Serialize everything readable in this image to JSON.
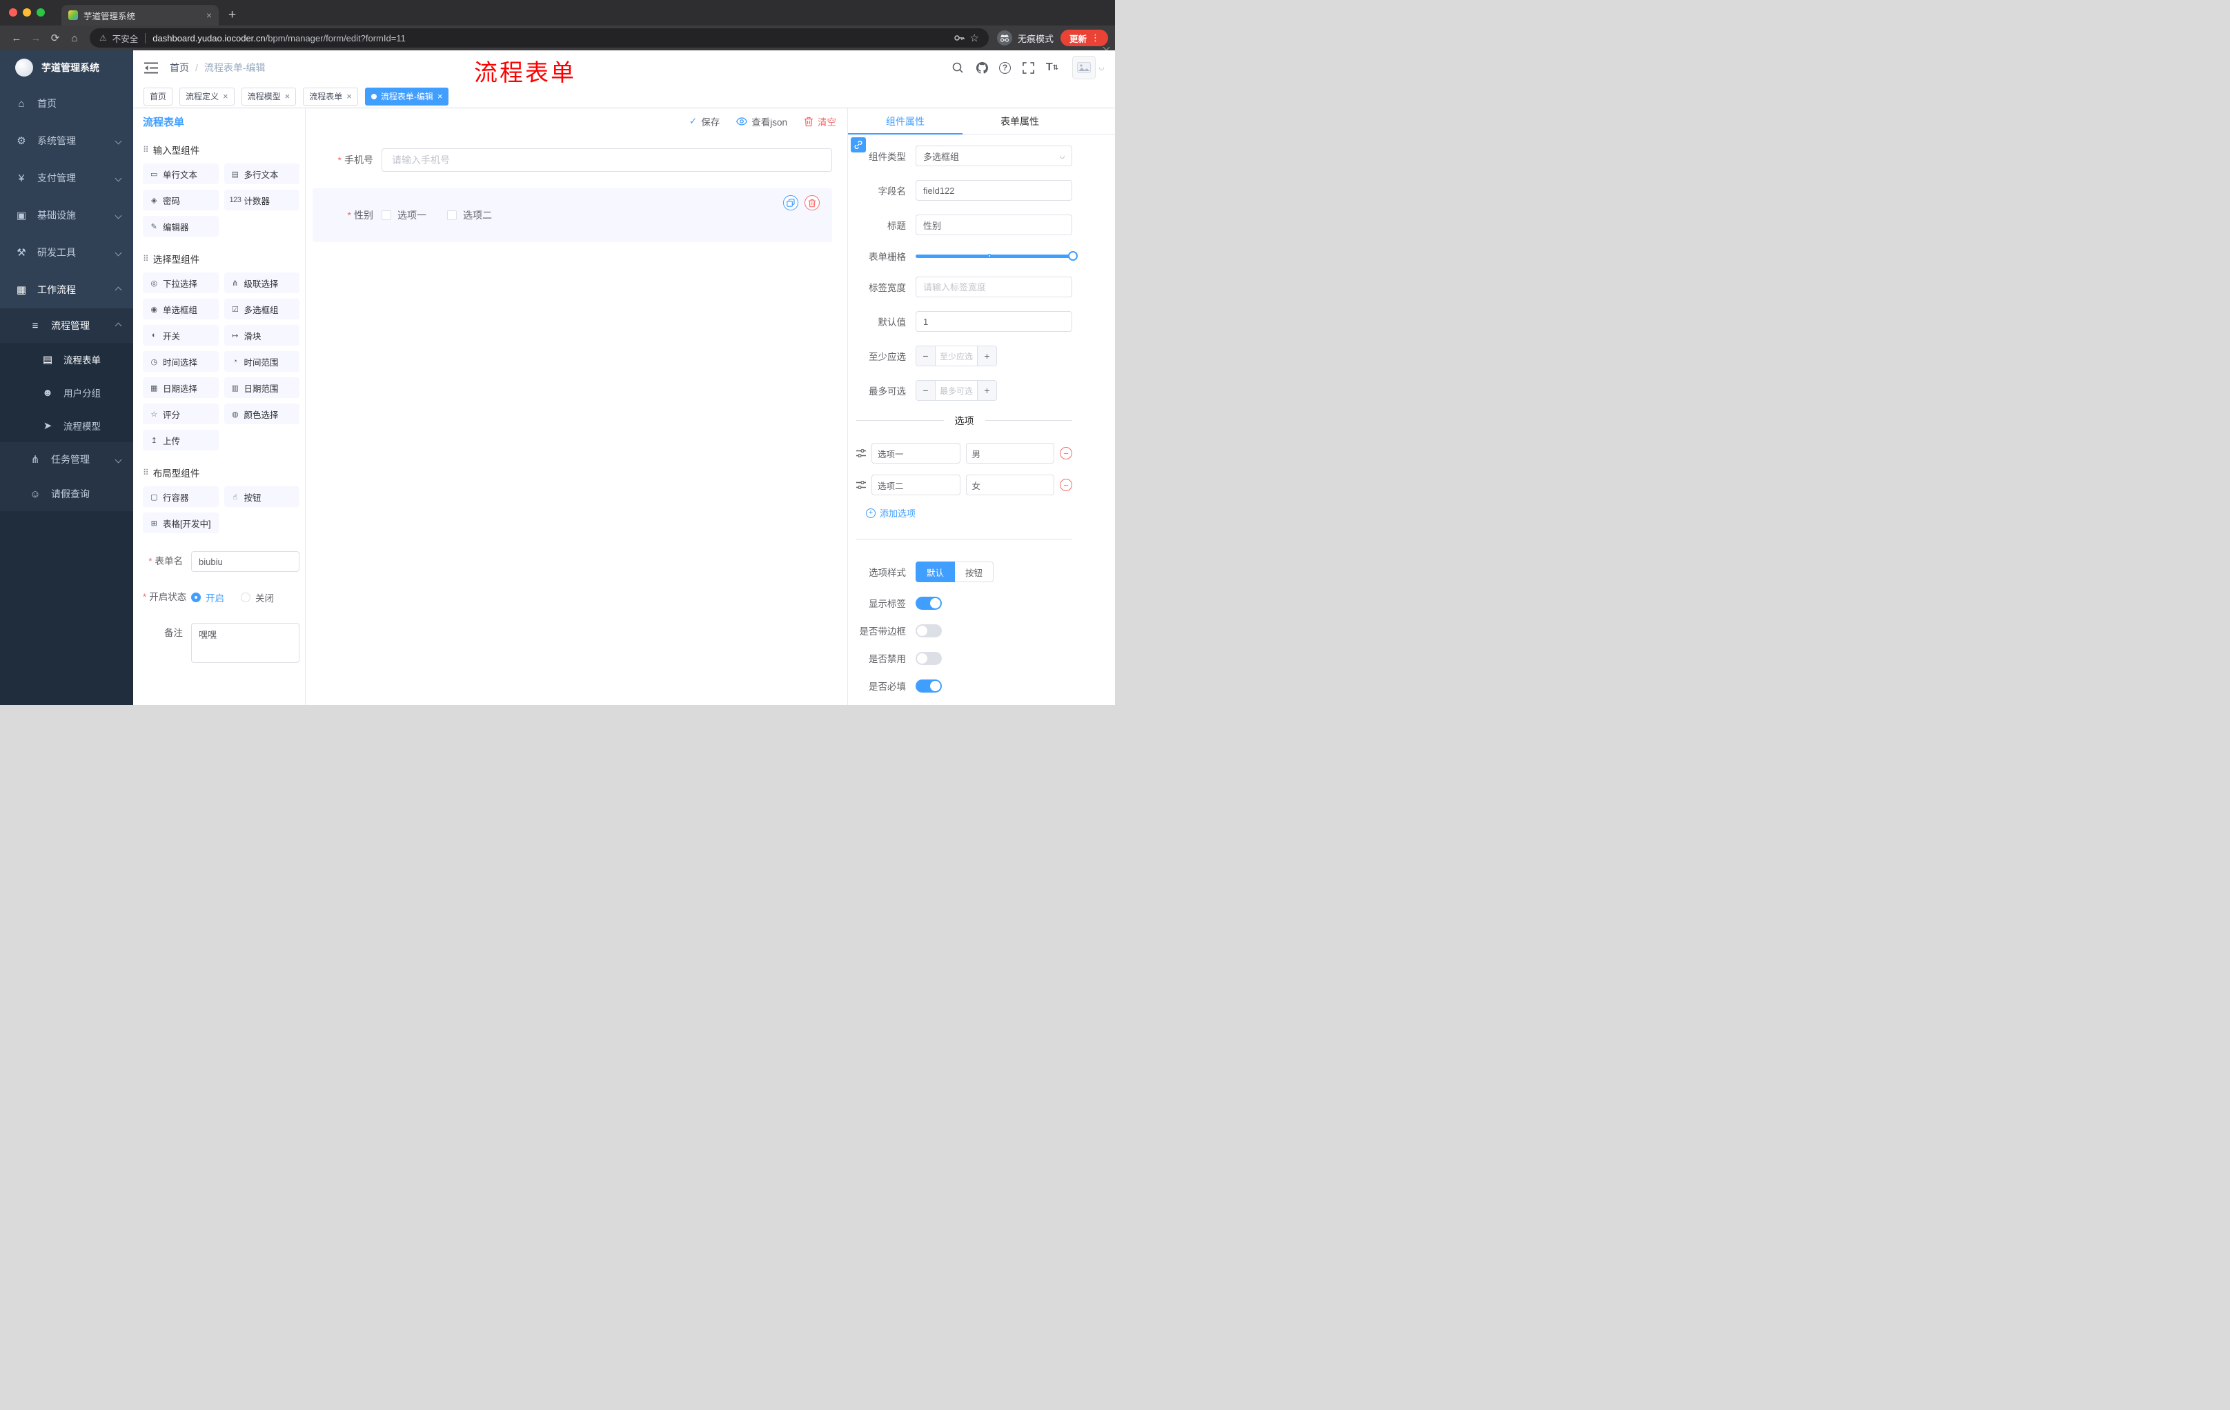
{
  "colors": {
    "primary": "#409eff",
    "danger": "#f56c6c",
    "annotation_red": "#fe0000",
    "sidebar_bg": "#304156",
    "chip_bg": "#f6f7ff",
    "active_tag": "#409eff"
  },
  "browser": {
    "tab_title": "芋道管理系统",
    "security": "不安全",
    "url_host": "dashboard.yudao.iocoder.cn",
    "url_path": "/bpm/manager/form/edit?formId=11",
    "incognito": "无痕模式",
    "update": "更新"
  },
  "annotation": "流程表单",
  "sidebar": {
    "title": "芋道管理系统",
    "items": [
      {
        "label": "首页",
        "glyph": "⌂"
      },
      {
        "label": "系统管理",
        "glyph": "⚙"
      },
      {
        "label": "支付管理",
        "glyph": "¥"
      },
      {
        "label": "基础设施",
        "glyph": "▣"
      },
      {
        "label": "研发工具",
        "glyph": "⚒"
      },
      {
        "label": "工作流程",
        "glyph": "▦"
      }
    ],
    "sub": {
      "process": {
        "label": "流程管理",
        "glyph": "≡"
      },
      "form": {
        "label": "流程表单",
        "glyph": "▤"
      },
      "group": {
        "label": "用户分组",
        "glyph": "☻"
      },
      "model": {
        "label": "流程模型",
        "glyph": "➤"
      },
      "task": {
        "label": "任务管理",
        "glyph": "⋔"
      },
      "leave": {
        "label": "请假查询",
        "glyph": "☺"
      }
    }
  },
  "header": {
    "crumb1": "首页",
    "crumb2": "流程表单-编辑"
  },
  "tags": [
    {
      "label": "首页"
    },
    {
      "label": "流程定义"
    },
    {
      "label": "流程模型"
    },
    {
      "label": "流程表单"
    },
    {
      "label": "流程表单-编辑"
    }
  ],
  "designer": {
    "panel_title": "流程表单",
    "save": "保存",
    "view_json": "查看json",
    "clear": "清空",
    "sections": [
      {
        "title": "输入型组件",
        "items": [
          {
            "label": "单行文本",
            "glyph": "▭"
          },
          {
            "label": "多行文本",
            "glyph": "▤"
          },
          {
            "label": "密码",
            "glyph": "◈"
          },
          {
            "label": "计数器",
            "glyph": "123"
          },
          {
            "label": "编辑器",
            "glyph": "✎"
          }
        ]
      },
      {
        "title": "选择型组件",
        "items": [
          {
            "label": "下拉选择",
            "glyph": "◎"
          },
          {
            "label": "级联选择",
            "glyph": "⋔"
          },
          {
            "label": "单选框组",
            "glyph": "◉"
          },
          {
            "label": "多选框组",
            "glyph": "☑"
          },
          {
            "label": "开关",
            "glyph": "◐"
          },
          {
            "label": "滑块",
            "glyph": "↦"
          },
          {
            "label": "时间选择",
            "glyph": "◷"
          },
          {
            "label": "时间范围",
            "glyph": "◔"
          },
          {
            "label": "日期选择",
            "glyph": "▦"
          },
          {
            "label": "日期范围",
            "glyph": "▥"
          },
          {
            "label": "评分",
            "glyph": "☆"
          },
          {
            "label": "颜色选择",
            "glyph": "◍"
          },
          {
            "label": "上传",
            "glyph": "↥"
          }
        ]
      },
      {
        "title": "布局型组件",
        "items": [
          {
            "label": "行容器",
            "glyph": "▢"
          },
          {
            "label": "按钮",
            "glyph": "☝"
          },
          {
            "label": "表格[开发中]",
            "glyph": "⊞"
          }
        ]
      }
    ],
    "meta": {
      "name_label": "表单名",
      "name_value": "biubiu",
      "status_label": "开启状态",
      "status_on": "开启",
      "status_off": "关闭",
      "remark_label": "备注",
      "remark_value": "嘿嘿"
    },
    "canvas": {
      "phone_label": "手机号",
      "phone_placeholder": "请输入手机号",
      "gender_label": "性别",
      "opt1": "选项一",
      "opt2": "选项二"
    }
  },
  "props": {
    "tab_component": "组件属性",
    "tab_form": "表单属性",
    "type_label": "组件类型",
    "type_value": "多选框组",
    "field_label": "字段名",
    "field_value": "field122",
    "title_label": "标题",
    "title_value": "性别",
    "grid_label": "表单栅格",
    "labelw_label": "标签宽度",
    "labelw_placeholder": "请输入标签宽度",
    "default_label": "默认值",
    "default_value": "1",
    "min_label": "至少应选",
    "min_placeholder": "至少应选",
    "max_label": "最多可选",
    "max_placeholder": "最多可选",
    "options_title": "选项",
    "opt1_name": "选项一",
    "opt1_value": "男",
    "opt2_name": "选项二",
    "opt2_value": "女",
    "add_option": "添加选项",
    "style_label": "选项样式",
    "style_default": "默认",
    "style_button": "按钮",
    "sw_show_label": "显示标签",
    "sw_border": "是否带边框",
    "sw_disabled": "是否禁用",
    "sw_required": "是否必填"
  }
}
